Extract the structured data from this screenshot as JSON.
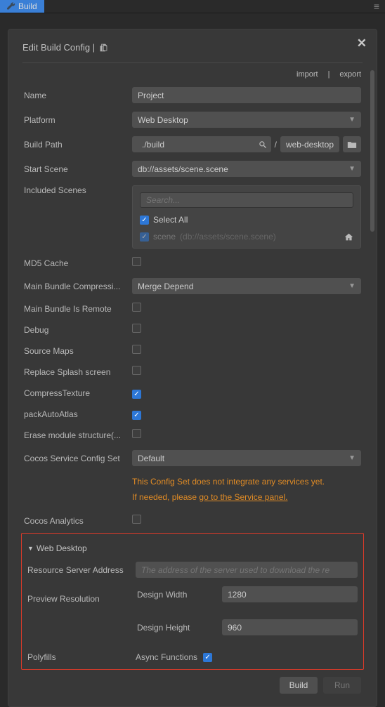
{
  "tab_label": "Build",
  "panel": {
    "title": "Edit Build Config |",
    "close": "✕"
  },
  "actions": {
    "import": "import",
    "export": "export"
  },
  "form": {
    "name_label": "Name",
    "name_value": "Project",
    "platform_label": "Platform",
    "platform_value": "Web Desktop",
    "buildpath_label": "Build Path",
    "buildpath_value": "./build",
    "buildpath_suffix": "web-desktop",
    "startscene_label": "Start Scene",
    "startscene_value": "db://assets/scene.scene",
    "included_label": "Included Scenes",
    "search_placeholder": "Search...",
    "select_all": "Select All",
    "scene_name": "scene",
    "scene_path": "(db://assets/scene.scene)",
    "md5_label": "MD5 Cache",
    "bundle_comp_label": "Main Bundle Compressi...",
    "bundle_comp_value": "Merge Depend",
    "remote_label": "Main Bundle Is Remote",
    "debug_label": "Debug",
    "sourcemaps_label": "Source Maps",
    "splash_label": "Replace Splash screen",
    "compresstex_label": "CompressTexture",
    "autoatlas_label": "packAutoAtlas",
    "erase_label": "Erase module structure(...",
    "service_label": "Cocos Service Config Set",
    "service_value": "Default",
    "warn_l1": "This Config Set does not integrate any services yet.",
    "warn_l2a": "If needed, please ",
    "warn_l2b": "go to the Service panel.",
    "analytics_label": "Cocos Analytics",
    "section_title": "Web Desktop",
    "resource_label": "Resource Server Address",
    "resource_placeholder": "The address of the server used to download the re",
    "preview_label": "Preview Resolution",
    "design_width_label": "Design Width",
    "design_width_value": "1280",
    "design_height_label": "Design Height",
    "design_height_value": "960",
    "polyfills_label": "Polyfills",
    "async_label": "Async Functions"
  },
  "buttons": {
    "build": "Build",
    "run": "Run"
  }
}
